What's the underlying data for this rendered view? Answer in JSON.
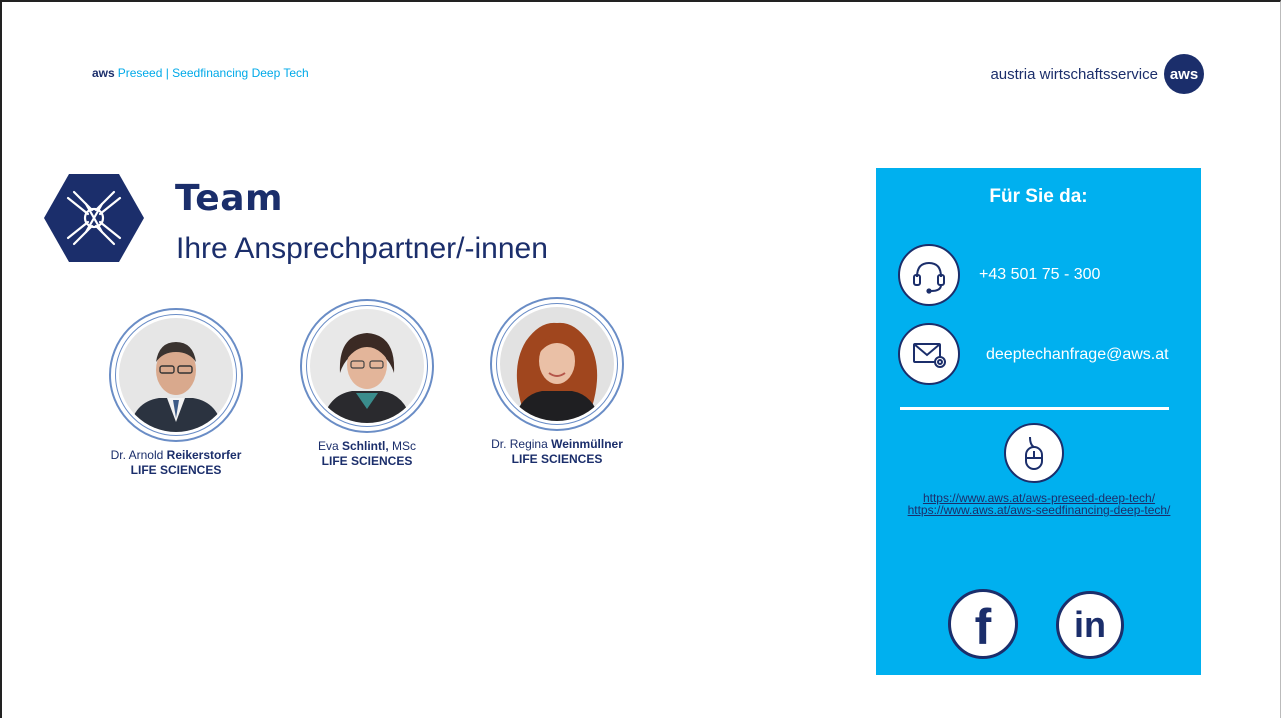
{
  "header": {
    "brand": "aws",
    "program": "Preseed | Seedfinancing Deep Tech",
    "tagline": "austria wirtschaftsservice",
    "logo": "aws"
  },
  "title": "Team",
  "subtitle": "Ihre Ansprechpartner/-innen",
  "team": [
    {
      "prefix": "Dr. Arnold ",
      "surname": "Reikerstorfer",
      "suffix": "",
      "dept": "LIFE SCIENCES"
    },
    {
      "prefix": "Eva ",
      "surname": "Schlintl,",
      "suffix": " MSc",
      "dept": "LIFE SCIENCES"
    },
    {
      "prefix": "Dr. Regina ",
      "surname": "Weinmüllner",
      "suffix": "",
      "dept": "LIFE SCIENCES"
    }
  ],
  "contact": {
    "heading": "Für Sie da:",
    "phone": "+43 501 75 - 300",
    "email": "deeptechanfrage@aws.at",
    "link1": "https://www.aws.at/aws-preseed-deep-tech/",
    "link2": "https://www.aws.at/aws-seedfinancing-deep-tech/",
    "facebook_glyph": "f",
    "linkedin_glyph": "in"
  },
  "colors": {
    "navy": "#1b2e6b",
    "cyan": "#00b0ef",
    "link_blue": "#00a9e8"
  },
  "icons": [
    "team-hands-icon",
    "headset-icon",
    "mail-icon",
    "mouse-icon",
    "facebook-icon",
    "linkedin-icon"
  ]
}
